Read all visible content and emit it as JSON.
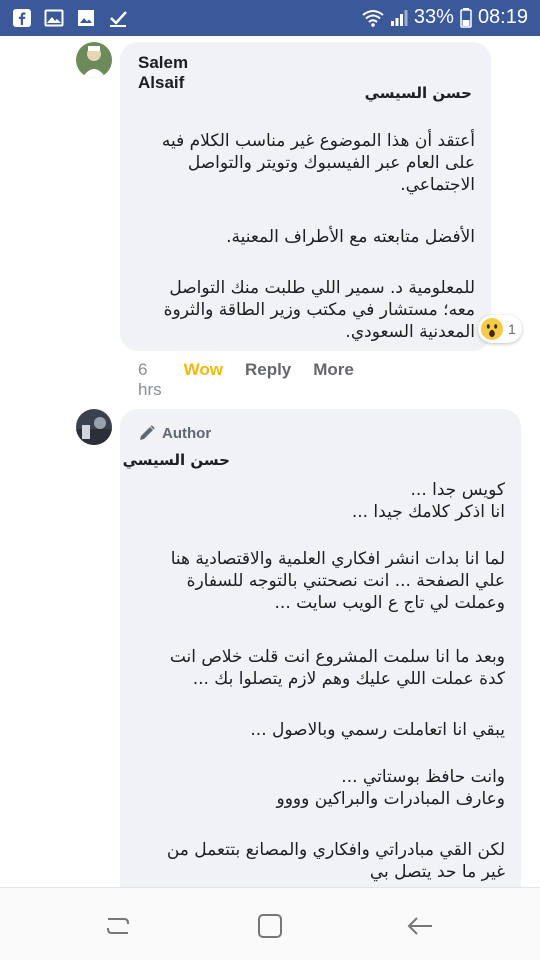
{
  "status_bar": {
    "battery": "33%",
    "time": "08:19",
    "icons": [
      "facebook-icon",
      "image-icon",
      "gallery-icon",
      "checkmark-icon",
      "wifi-icon",
      "signal-icon",
      "battery-icon"
    ]
  },
  "comments": [
    {
      "author": "Salem Alsaif",
      "title": "حسن السيسي",
      "paragraphs": [
        "أعتقد أن هذا الموضوع غير مناسب الكلام فيه على العام عبر الفيسبوك وتويتر والتواصل الاجتماعي.",
        "الأفضل متابعته مع الأطراف المعنية.",
        "للمعلومية د. سمير اللي طلبت منك التواصل معه؛ مستشار في مكتب وزير الطاقة والثروة المعدنية السعودي."
      ],
      "reaction_count": "1",
      "actions": {
        "time": "6 hrs",
        "reaction": "Wow",
        "reply": "Reply",
        "more": "More"
      }
    },
    {
      "badge": "Author",
      "title": "حسن السيسي",
      "paragraphs": [
        "كويس جدا ...\nانا اذكر كلامك جيدا ...",
        "لما انا بدات انشر افكاري العلمية والاقتصادية هنا علي الصفحة ... انت نصحتني بالتوجه للسفارة وعملت لي تاج ع الويب سايت ...",
        "وبعد ما انا سلمت المشروع انت قلت خلاص انت كدة عملت اللي عليك وهم لازم يتصلوا بك ...",
        "يبقي انا اتعاملت رسمي وبالاصول ...",
        "وانت حافظ بوستاتي ...\nوعارف المبادرات والبراكين وووو",
        "لكن القي مبادراتي وافكاري والمصانع بتتعمل من غير ما حد يتصل بي"
      ]
    }
  ],
  "colors": {
    "status_bar": "#3b5998",
    "bubble": "#f0f2f5",
    "wow": "#f0b90b",
    "text": "#1c1e21",
    "muted": "#65676b"
  }
}
